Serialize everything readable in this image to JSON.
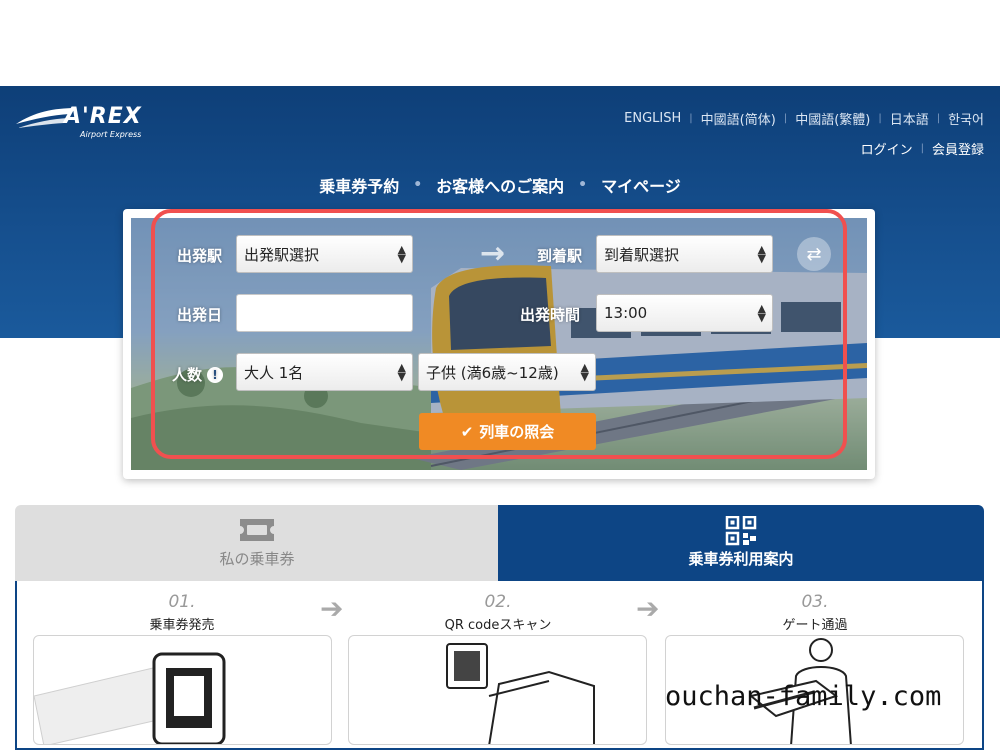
{
  "brand": {
    "name": "A'REX",
    "tagline": "Airport Express"
  },
  "languages": [
    "ENGLISH",
    "中國語(简体)",
    "中國語(繁體)",
    "日本語",
    "한국어"
  ],
  "account": {
    "login": "ログイン",
    "register": "会員登録"
  },
  "nav": [
    "乗車券予約",
    "お客様へのご案内",
    "マイページ"
  ],
  "booking": {
    "departure_label": "出発駅",
    "departure_value": "出発駅選択",
    "arrival_label": "到着駅",
    "arrival_value": "到着駅選択",
    "date_label": "出発日",
    "date_value": "",
    "time_label": "出発時間",
    "time_value": "13:00",
    "people_label": "人数",
    "adult_value": "大人 1名",
    "child_value": "子供 (満6歳~12歳)",
    "search_button": "列車の照会"
  },
  "tabs": {
    "my_tickets": "私の乗車券",
    "guide": "乗車券利用案内"
  },
  "steps": [
    {
      "num": "01.",
      "title": "乗車券発売"
    },
    {
      "num": "02.",
      "title": "QR codeスキャン"
    },
    {
      "num": "03.",
      "title": "ゲート通過"
    }
  ],
  "watermark": "ouchan-family.com",
  "colors": {
    "header": "#0e3f78",
    "accent": "#f08a24",
    "highlight": "#f0504f",
    "tab_active": "#0d4585"
  }
}
